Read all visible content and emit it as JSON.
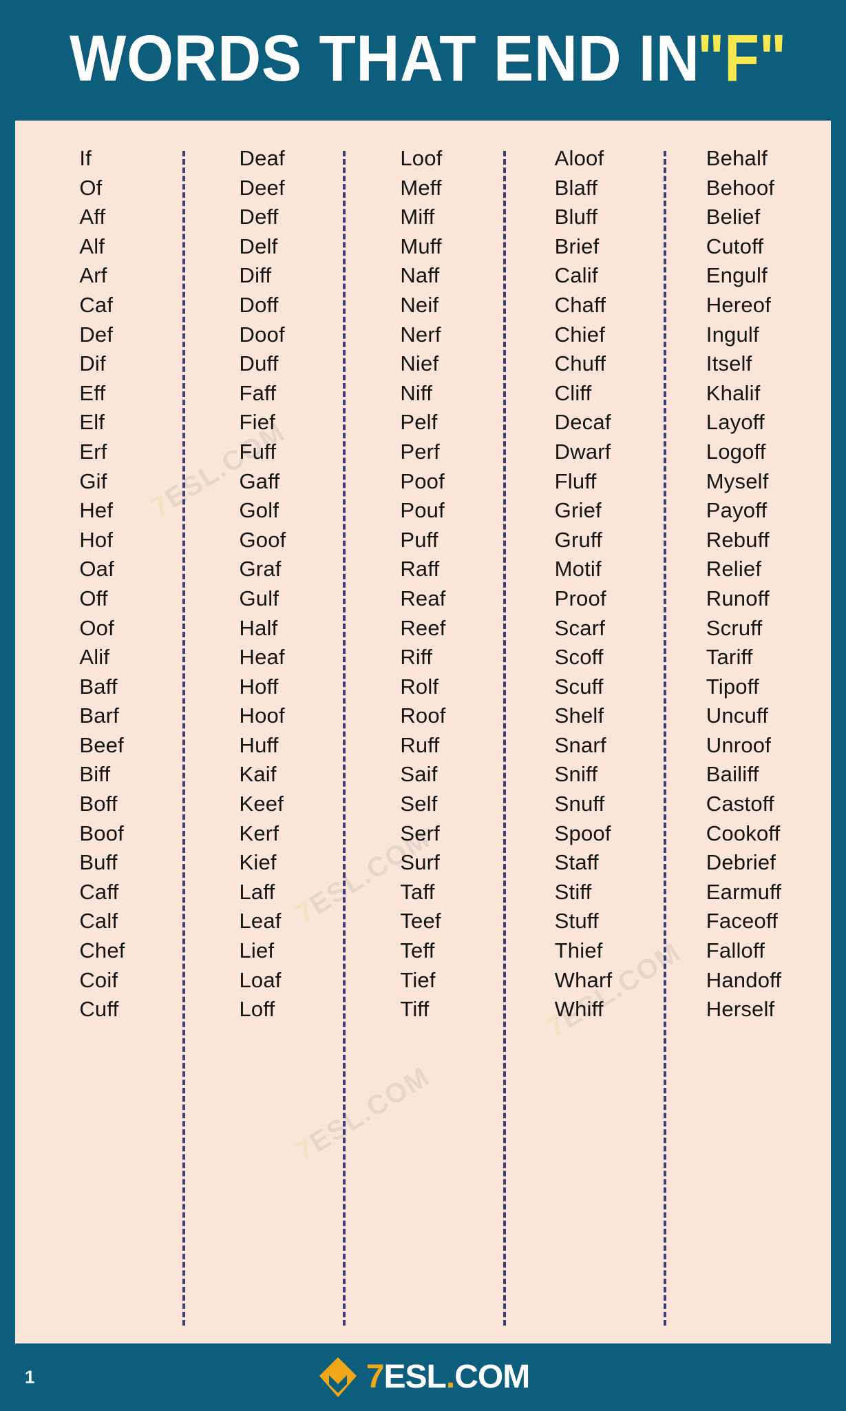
{
  "header": {
    "title_main": "WORDS THAT END IN",
    "title_accent": "\"F\""
  },
  "colors": {
    "background": "#0d5e7d",
    "card": "#fae5d8",
    "accent_yellow": "#f7e84f",
    "brand_orange": "#f0a818",
    "divider": "#3a3f77",
    "text": "#141414"
  },
  "watermark": {
    "text_7": "7",
    "text_rest": "ESL.COM"
  },
  "footer": {
    "page_number": "1",
    "brand_7": "7",
    "brand_esl": "ESL",
    "brand_dot": ".",
    "brand_com": "COM",
    "logo_icon": "diamond-7esl-logo-icon"
  },
  "columns": [
    {
      "id": "column-1",
      "words": [
        "If",
        "Of",
        "Aff",
        "Alf",
        "Arf",
        "Caf",
        "Def",
        "Dif",
        "Eff",
        "Elf",
        "Erf",
        "Gif",
        "Hef",
        "Hof",
        "Oaf",
        "Off",
        "Oof",
        "Alif",
        "Baff",
        "Barf",
        "Beef",
        "Biff",
        "Boff",
        "Boof",
        "Buff",
        "Caff",
        "Calf",
        "Chef",
        "Coif",
        "Cuff"
      ]
    },
    {
      "id": "column-2",
      "words": [
        "Deaf",
        "Deef",
        "Deff",
        "Delf",
        "Diff",
        "Doff",
        "Doof",
        "Duff",
        "Faff",
        "Fief",
        "Fuff",
        "Gaff",
        "Golf",
        "Goof",
        "Graf",
        "Gulf",
        "Half",
        "Heaf",
        "Hoff",
        "Hoof",
        "Huff",
        "Kaif",
        "Keef",
        "Kerf",
        "Kief",
        "Laff",
        "Leaf",
        "Lief",
        "Loaf",
        "Loff"
      ]
    },
    {
      "id": "column-3",
      "words": [
        "Loof",
        "Meff",
        "Miff",
        "Muff",
        "Naff",
        "Neif",
        "Nerf",
        "Nief",
        "Niff",
        "Pelf",
        "Perf",
        "Poof",
        "Pouf",
        "Puff",
        "Raff",
        "Reaf",
        "Reef",
        "Riff",
        "Rolf",
        "Roof",
        "Ruff",
        "Saif",
        "Self",
        "Serf",
        "Surf",
        "Taff",
        "Teef",
        "Teff",
        "Tief",
        "Tiff"
      ]
    },
    {
      "id": "column-4",
      "words": [
        "Aloof",
        "Blaff",
        "Bluff",
        "Brief",
        "Calif",
        "Chaff",
        "Chief",
        "Chuff",
        "Cliff",
        "Decaf",
        "Dwarf",
        "Fluff",
        "Grief",
        "Gruff",
        "Motif",
        "Proof",
        "Scarf",
        "Scoff",
        "Scuff",
        "Shelf",
        "Snarf",
        "Sniff",
        "Snuff",
        "Spoof",
        "Staff",
        "Stiff",
        "Stuff",
        "Thief",
        "Wharf",
        "Whiff"
      ]
    },
    {
      "id": "column-5",
      "words": [
        "Behalf",
        "Behoof",
        "Belief",
        "Cutoff",
        "Engulf",
        "Hereof",
        "Ingulf",
        "Itself",
        "Khalif",
        "Layoff",
        "Logoff",
        "Myself",
        "Payoff",
        "Rebuff",
        "Relief",
        "Runoff",
        "Scruff",
        "Tariff",
        "Tipoff",
        "Uncuff",
        "Unroof",
        "Bailiff",
        "Castoff",
        "Cookoff",
        "Debrief",
        "Earmuff",
        "Faceoff",
        "Falloff",
        "Handoff",
        "Herself"
      ]
    }
  ]
}
